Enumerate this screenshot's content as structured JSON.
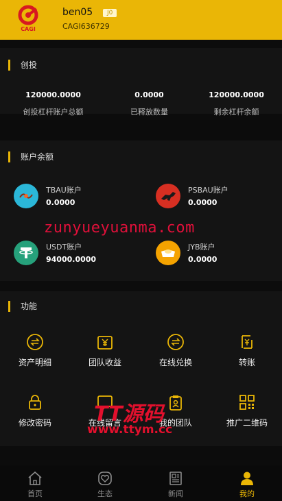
{
  "header": {
    "username": "ben05",
    "level": "J0",
    "user_id": "CAGI636729",
    "logo_text": "CAGI"
  },
  "invest": {
    "title": "创投",
    "stats": [
      {
        "value": "120000.0000",
        "label": "创投杠杆账户总额"
      },
      {
        "value": "0.0000",
        "label": "已释放数量"
      },
      {
        "value": "120000.0000",
        "label": "剩余杠杆余额"
      }
    ]
  },
  "balance": {
    "title": "账户余额",
    "accounts": [
      {
        "name": "TBAU账户",
        "amount": "0.0000",
        "icon": "tbau-icon",
        "color": "#2bb7d8"
      },
      {
        "name": "PSBAU账户",
        "amount": "0.0000",
        "icon": "psbau-horse-icon",
        "color": "#d72f22"
      },
      {
        "name": "USDT账户",
        "amount": "94000.0000",
        "icon": "usdt-tether-icon",
        "color": "#26a17b"
      },
      {
        "name": "JYB账户",
        "amount": "0.0000",
        "icon": "gold-ingot-icon",
        "color": "#f5a300"
      }
    ]
  },
  "functions": {
    "title": "功能",
    "items": [
      {
        "label": "资产明细",
        "icon": "exchange-icon"
      },
      {
        "label": "团队收益",
        "icon": "yen-wallet-icon"
      },
      {
        "label": "在线兑换",
        "icon": "exchange-icon"
      },
      {
        "label": "转账",
        "icon": "transfer-icon"
      },
      {
        "label": "修改密码",
        "icon": "lock-icon"
      },
      {
        "label": "在线留言",
        "icon": "message-icon"
      },
      {
        "label": "我的团队",
        "icon": "team-clipboard-icon"
      },
      {
        "label": "推广二维码",
        "icon": "qr-code-icon"
      }
    ]
  },
  "watermarks": {
    "line1": "zunyueyuanma.com",
    "line2": "TT源码",
    "line3": "www.ttym.cc"
  },
  "tabbar": {
    "tabs": [
      {
        "label": "首页",
        "icon": "home-icon",
        "active": false
      },
      {
        "label": "生态",
        "icon": "heart-icon",
        "active": false
      },
      {
        "label": "新闻",
        "icon": "news-icon",
        "active": false
      },
      {
        "label": "我的",
        "icon": "user-icon",
        "active": true
      }
    ]
  },
  "colors": {
    "accent": "#eab606",
    "background": "#0c0c0c",
    "card": "#141414",
    "watermark": "#e3102d"
  }
}
